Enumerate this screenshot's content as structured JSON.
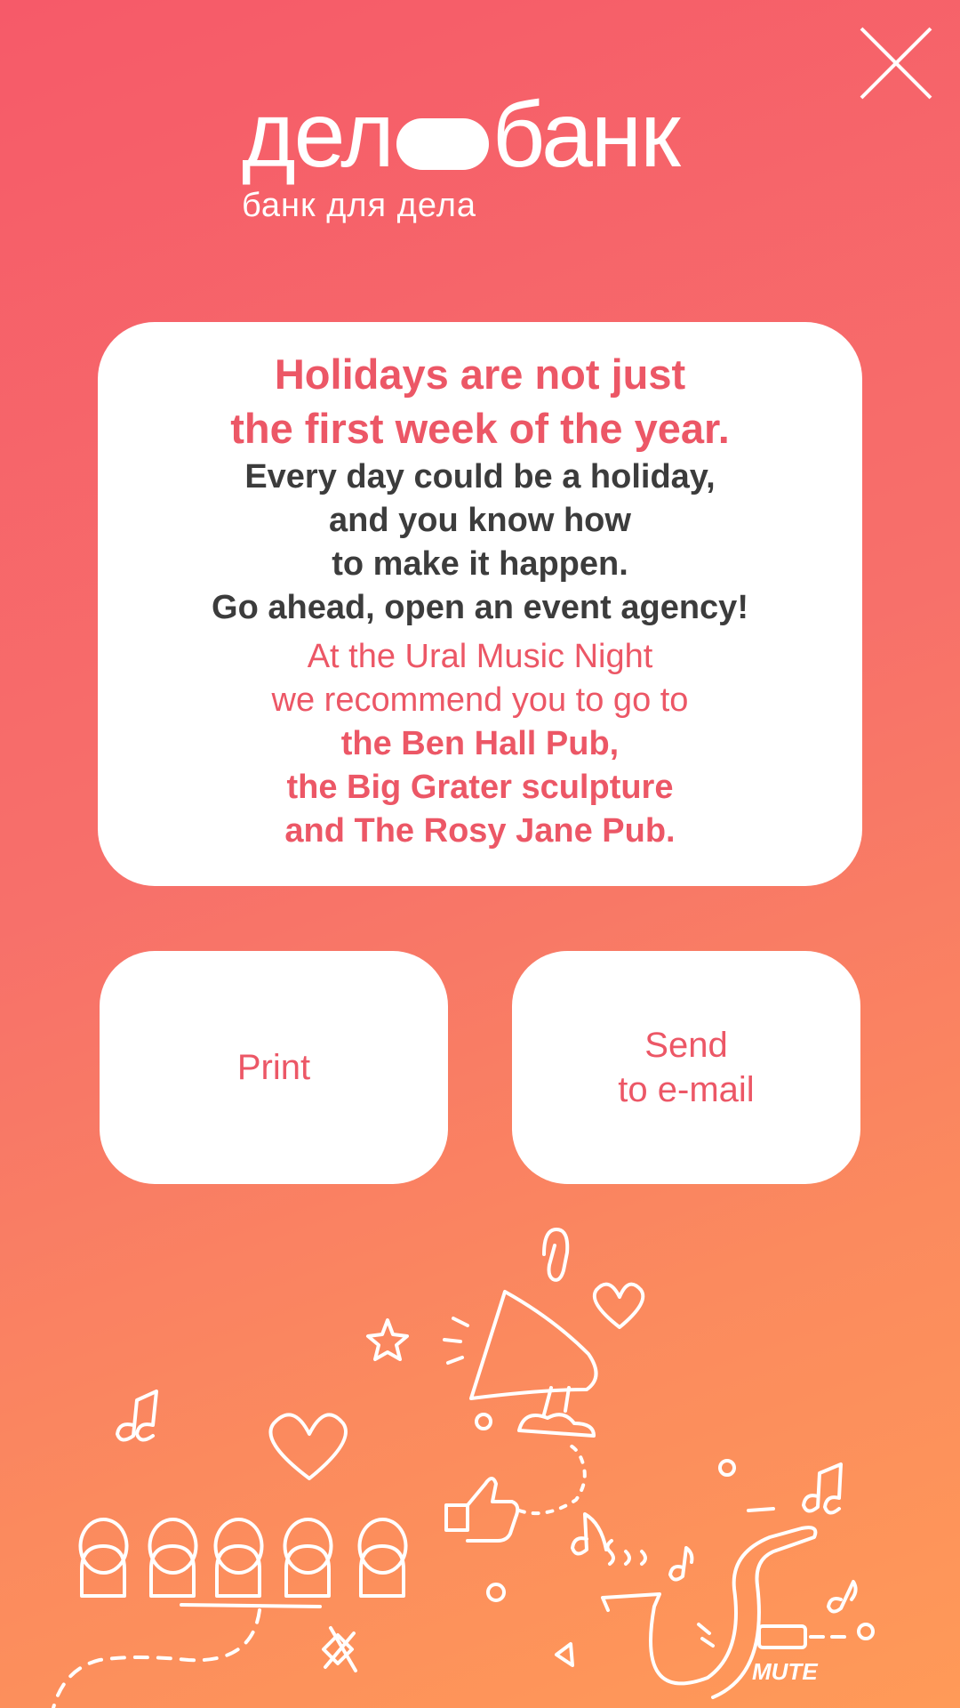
{
  "logo": {
    "main_left": "дел",
    "main_right": "банк",
    "tagline": "банк для дела"
  },
  "card": {
    "headline": [
      "Holidays are not just",
      "the first week of the year."
    ],
    "body": [
      "Every day could be a holiday,",
      "and you know how",
      "to make it happen.",
      "Go ahead, open an event agency!"
    ],
    "recommend": [
      "At the Ural Music Night",
      "we recommend you to go to"
    ],
    "places": [
      "the Ben Hall Pub,",
      "the Big Grater sculpture",
      "and The Rosy Jane Pub."
    ]
  },
  "buttons": {
    "print": "Print",
    "email": [
      "Send",
      "to e-mail"
    ]
  },
  "doodle": {
    "mute_label": "MUTE"
  },
  "colors": {
    "accent": "#ec5766",
    "text_dark": "#3c3c3c",
    "bg_top": "#f65a69",
    "bg_bottom": "#ff9a58"
  },
  "icons": {
    "close": "close-icon"
  }
}
